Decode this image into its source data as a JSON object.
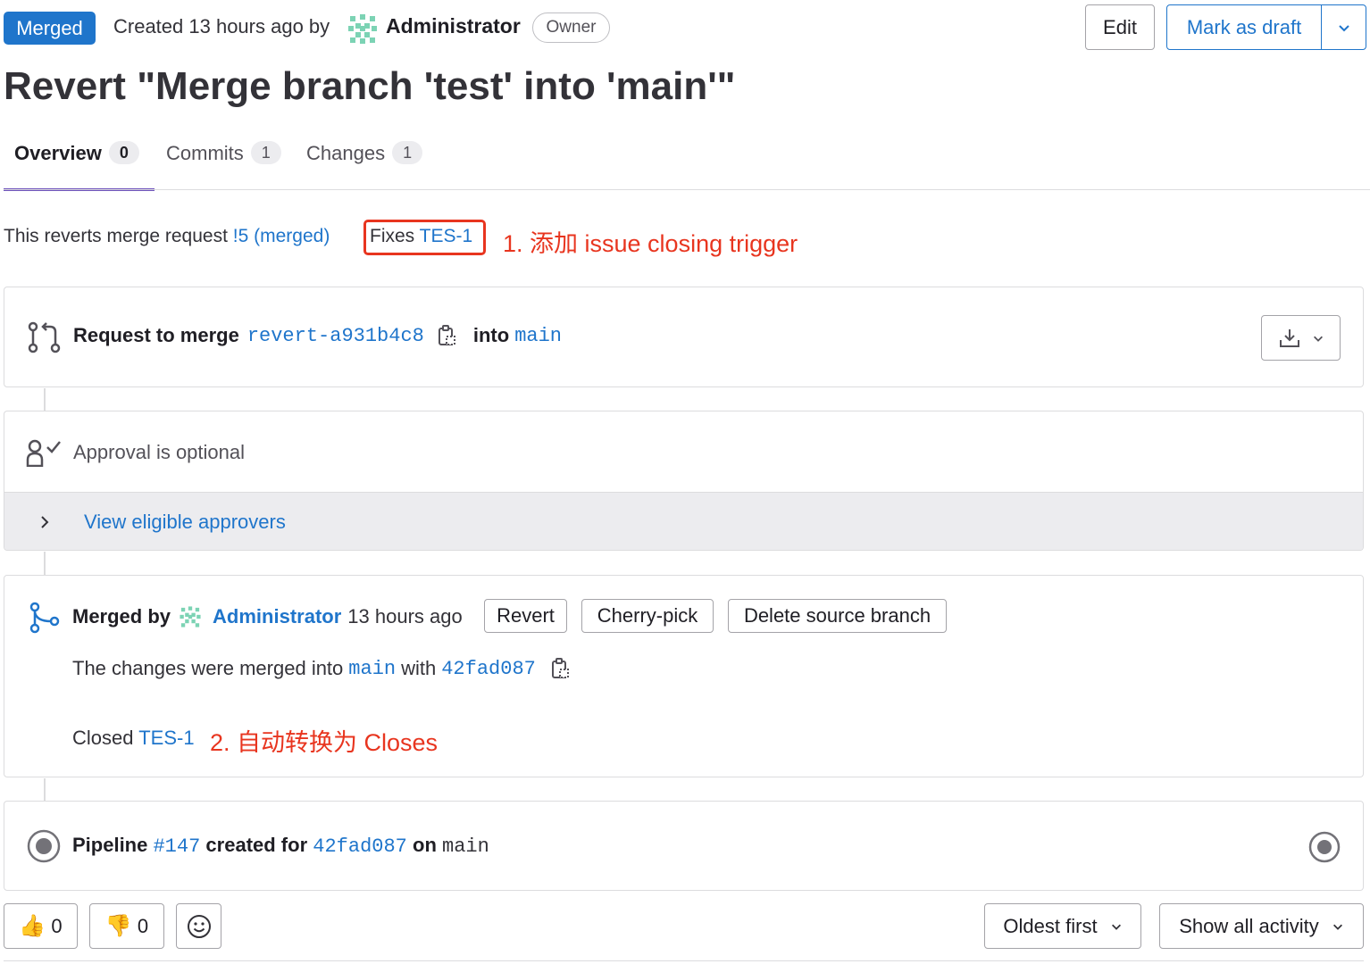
{
  "header": {
    "status_badge": "Merged",
    "created_text": "Created 13 hours ago by",
    "author": "Administrator",
    "role_badge": "Owner",
    "edit_label": "Edit",
    "mark_draft_label": "Mark as draft"
  },
  "title": "Revert \"Merge branch 'test' into 'main'\"",
  "tabs": [
    {
      "label": "Overview",
      "count": "0"
    },
    {
      "label": "Commits",
      "count": "1"
    },
    {
      "label": "Changes",
      "count": "1"
    }
  ],
  "description": {
    "text": "This reverts merge request",
    "mr_link": "!5 (merged)",
    "fixes_prefix": "Fixes",
    "fixes_issue": "TES-1",
    "annotation": "1. 添加 issue closing trigger"
  },
  "merge_request": {
    "prefix": "Request to merge",
    "source_branch": "revert-a931b4c8",
    "into_text": "into",
    "target_branch": "main"
  },
  "approval": {
    "text": "Approval is optional",
    "view_approvers": "View eligible approvers"
  },
  "merged": {
    "prefix": "Merged by",
    "user": "Administrator",
    "time": "13 hours ago",
    "revert_label": "Revert",
    "cherry_pick_label": "Cherry-pick",
    "delete_branch_label": "Delete source branch",
    "changes_text": "The changes were merged into",
    "changes_branch": "main",
    "with_text": "with",
    "commit": "42fad087",
    "closed_text": "Closed",
    "closed_issue": "TES-1",
    "annotation": "2. 自动转换为 Closes"
  },
  "pipeline": {
    "label": "Pipeline",
    "id": "#147",
    "created_for": "created for",
    "commit": "42fad087",
    "on_text": "on",
    "branch": "main"
  },
  "reactions": {
    "thumbs_up": "0",
    "thumbs_down": "0"
  },
  "sort": {
    "order_label": "Oldest first",
    "filter_label": "Show all activity"
  },
  "colors": {
    "merged_badge": "#1f75cb",
    "link": "#1f75cb",
    "annotation": "#e8351f",
    "active_tab": "#6b4fbb"
  }
}
